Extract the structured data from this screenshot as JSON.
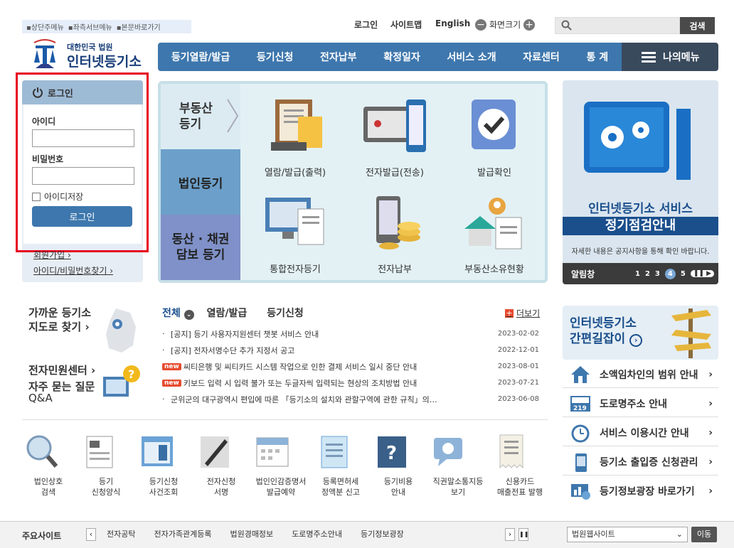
{
  "skip_links": [
    "상단주메뉴",
    "좌측서브메뉴",
    "본문바로가기"
  ],
  "top_links": {
    "login": "로그인",
    "sitemap": "사이트맵",
    "english": "English",
    "zoom": "화면크기"
  },
  "search": {
    "button": "검색"
  },
  "logo": {
    "sub": "대한민국 법원",
    "main": "인터넷등기소"
  },
  "nav": [
    "등기열람/발급",
    "등기신청",
    "전자납부",
    "확정일자",
    "서비스 소개",
    "자료센터",
    "통 계"
  ],
  "my_menu": "나의메뉴",
  "login": {
    "title": "로그인",
    "id_label": "아이디",
    "pw_label": "비밀번호",
    "save_id": "아이디저장",
    "button": "로그인",
    "join": "회원가입",
    "find": "아이디/비밀번호찾기"
  },
  "tabs": {
    "t1a": "부동산",
    "t1b": "등기",
    "t2": "법인등기",
    "t3a": "동산 · 채권",
    "t3b": "담보 등기"
  },
  "services": [
    "열람/발급(출력)",
    "전자발급(전송)",
    "발급확인",
    "통합전자등기",
    "전자납부",
    "부동산소유현황"
  ],
  "banner": {
    "line1": "인터넷등기소 서비스",
    "line2": "정기점검안내",
    "desc": "자세한 내용은 공지사항을 통해 확인 바랍니다.",
    "footer": "알림창",
    "pages": [
      "1",
      "2",
      "3",
      "4",
      "5"
    ],
    "active_page": 4
  },
  "left_links": {
    "map1": "가까운 등기소",
    "map2": "지도로 찾기",
    "center": "전자민원센터",
    "faq1": "자주 묻는 질문",
    "faq2": "Q&A"
  },
  "notice": {
    "tabs": [
      "전체",
      "열람/발급",
      "등기신청"
    ],
    "more": "더보기",
    "new_badge": "new",
    "items": [
      {
        "text": "[공지] 등기 사용자지원센터 챗봇 서비스 안내",
        "date": "2023-02-02",
        "new": false
      },
      {
        "text": "[공지] 전자서명수단 추가 지정서 공고",
        "date": "2022-12-01",
        "new": false
      },
      {
        "text": "씨티은행 및 씨티카드 시스템 작업으로 인한 결제 서비스 일시 중단 안내",
        "date": "2023-08-01",
        "new": true
      },
      {
        "text": "키보드 입력 시 입력 불가 또는 두글자씩 입력되는 현상의 조치방법 안내",
        "date": "2023-07-21",
        "new": true
      },
      {
        "text": "군위군의 대구광역시 편입에 따른 「등기소의 설치와 관할구역에 관한 규칙」의…",
        "date": "2023-06-08",
        "new": false
      }
    ]
  },
  "quick": [
    {
      "l1": "법인상호",
      "l2": "검색"
    },
    {
      "l1": "등기",
      "l2": "신청양식"
    },
    {
      "l1": "등기신청",
      "l2": "사건조회"
    },
    {
      "l1": "전자신청",
      "l2": "서명"
    },
    {
      "l1": "법인인감증명서",
      "l2": "발급예약"
    },
    {
      "l1": "등록면허세",
      "l2": "정액분 신고"
    },
    {
      "l1": "등기비용",
      "l2": "안내"
    },
    {
      "l1": "직권말소통지등",
      "l2": "보기"
    },
    {
      "l1": "신용카드",
      "l2": "매출전표 발행"
    }
  ],
  "guide": {
    "l1": "인터넷등기소",
    "l2": "간편길잡이"
  },
  "right_links": [
    "소액임차인의 범위 안내",
    "도로명주소 안내",
    "서비스 이용시간 안내",
    "등기소 출입증 신청관리",
    "등기정보광장 바로가기"
  ],
  "road_number": "219",
  "footer": {
    "title": "주요사이트",
    "sites": [
      "전자공탁",
      "전자가족관계등록",
      "법원경매정보",
      "도로명주소안내",
      "등기정보광장"
    ],
    "select": "법원웹사이트",
    "go": "이동"
  },
  "colors": {
    "nav_blue": "#3e77ad",
    "login_highlight": "#e6001e",
    "new_badge": "#e64a2e"
  }
}
